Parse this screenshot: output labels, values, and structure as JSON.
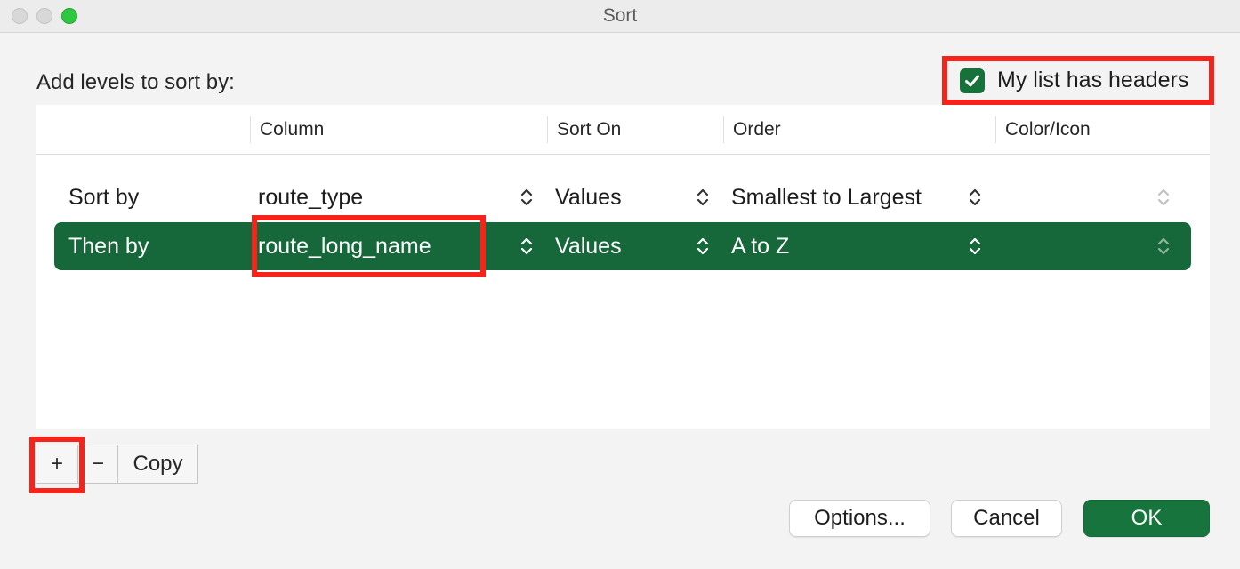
{
  "window": {
    "title": "Sort"
  },
  "add_levels_label": "Add levels to sort by:",
  "headers_checkbox": {
    "label": "My list has headers",
    "checked": true
  },
  "columns": [
    "Column",
    "Sort On",
    "Order",
    "Color/Icon"
  ],
  "rows": [
    {
      "label": "Sort by",
      "column": "route_type",
      "sort_on": "Values",
      "order": "Smallest to Largest",
      "color_icon": "",
      "selected": false
    },
    {
      "label": "Then by",
      "column": "route_long_name",
      "sort_on": "Values",
      "order": "A to Z",
      "color_icon": "",
      "selected": true
    }
  ],
  "level_buttons": {
    "add": "+",
    "remove": "−",
    "copy": "Copy"
  },
  "dialog_buttons": {
    "options": "Options...",
    "cancel": "Cancel",
    "ok": "OK"
  },
  "colors": {
    "accent_green": "#16683a",
    "annotation_red": "#f6231b"
  }
}
